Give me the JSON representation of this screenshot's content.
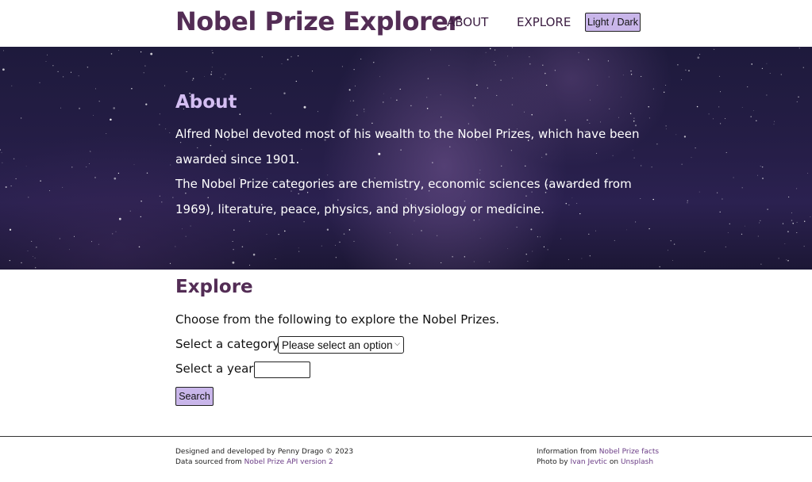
{
  "header": {
    "title": "Nobel Prize Explorer",
    "nav": [
      {
        "label": "ABOUT"
      },
      {
        "label": "EXPLORE"
      }
    ],
    "theme_toggle_label": "Light / Dark"
  },
  "about": {
    "heading": "About",
    "paragraphs": [
      "Alfred Nobel devoted most of his wealth to the Nobel Prizes, which have been awarded since 1901.",
      "The Nobel Prize categories are chemistry, economic sciences (awarded from 1969), literature, peace, physics, and physiology or medicine."
    ]
  },
  "explore": {
    "heading": "Explore",
    "intro": "Choose from the following to explore the Nobel Prizes.",
    "category_label": "Select a category:",
    "category_selected": "Please select an option",
    "year_label": "Select a year:",
    "year_value": "",
    "search_label": "Search"
  },
  "footer": {
    "left_line1": "Designed and developed by Penny Drago © 2023",
    "left_line2_prefix": "Data sourced from ",
    "left_line2_link": "Nobel Prize API version 2",
    "right_line1_prefix": "Information from ",
    "right_line1_link": "Nobel Prize facts",
    "right_line2_prefix": "Photo by ",
    "right_line2_link1": "Ivan Jevtic",
    "right_line2_mid": " on ",
    "right_line2_link2": "Unsplash"
  },
  "colors": {
    "brand": "#532d55",
    "accent_button": "#c9b6ea",
    "about_heading": "#d4bef2",
    "link": "#6a3c86"
  }
}
